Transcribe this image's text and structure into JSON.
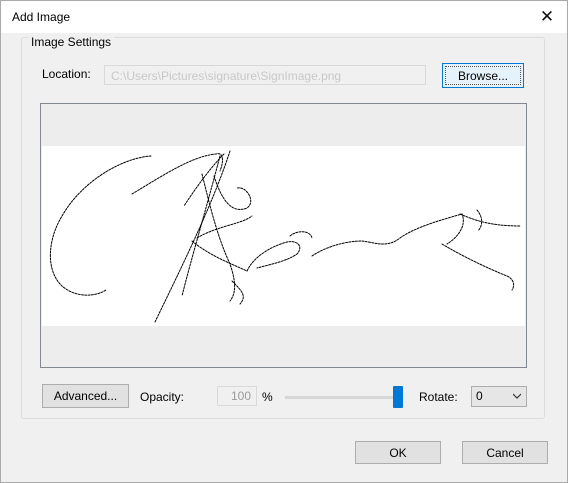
{
  "window": {
    "title": "Add Image",
    "close_glyph": "✕"
  },
  "settings": {
    "group_label": "Image Settings",
    "location_label": "Location:",
    "location_value": "C:\\Users\\Pictures\\signature\\SignImage.png",
    "browse_label": "Browse...",
    "advanced_label": "Advanced...",
    "opacity_label": "Opacity:",
    "opacity_value": "100",
    "opacity_unit": "%",
    "opacity_level_percent": 100,
    "rotate_label": "Rotate:",
    "rotate_value": "0"
  },
  "preview": {
    "image": "handwritten-signature"
  },
  "footer": {
    "ok_label": "OK",
    "cancel_label": "Cancel"
  },
  "colors": {
    "accent": "#0078d7",
    "dialog_bg": "#f0f0f0"
  }
}
